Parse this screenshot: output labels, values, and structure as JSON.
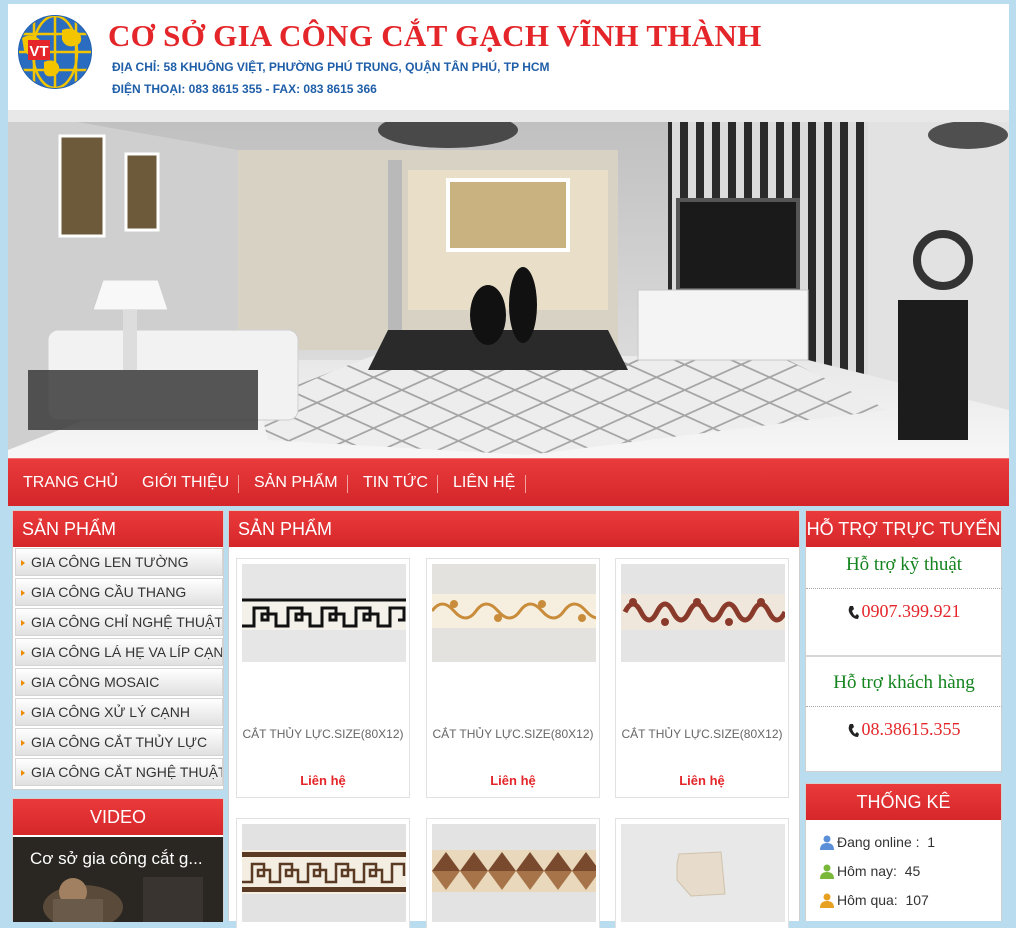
{
  "header": {
    "title": "CƠ SỞ GIA CÔNG CẮT GẠCH VĨNH THÀNH",
    "address": "ĐỊA CHỈ: 58 KHUÔNG VIỆT, PHƯỜNG PHÚ TRUNG, QUẬN TÂN PHÚ, TP HCM",
    "phone": "ĐIỆN THOẠI: 083 8615 355 -   FAX: 083 8615 366",
    "logo_text": "VT"
  },
  "nav": [
    "TRANG CHỦ",
    "GIỚI THIỆU",
    "SẢN PHẨM",
    "TIN TỨC",
    "LIÊN HỆ"
  ],
  "sidebar": {
    "title": "SẢN PHẨM",
    "items": [
      "GIA CÔNG LEN TƯỜNG",
      "GIA CÔNG CẦU THANG",
      "GIA CÔNG CHỈ NGHỆ THUẬT",
      "GIA CÔNG LÁ HẸ VA LÍP CẠNH",
      "GIA CÔNG MOSAIC",
      "GIA CÔNG XỬ LÝ CẠNH",
      "GIA CÔNG CẮT THỦY LỰC",
      "GIA CÔNG CẮT NGHỆ THUẬT"
    ],
    "video_title": "VIDEO",
    "video_caption": "Cơ sở gia công cắt g..."
  },
  "main": {
    "title": "SẢN PHẨM",
    "products": [
      {
        "name": "CẮT THỦY LỰC.SIZE(80X12)",
        "contact": "Liên hệ"
      },
      {
        "name": "CẮT THỦY LỰC.SIZE(80X12)",
        "contact": "Liên hệ"
      },
      {
        "name": "CẮT THỦY LỰC.SIZE(80X12)",
        "contact": "Liên hệ"
      }
    ]
  },
  "support": {
    "title": "HỖ TRỢ TRỰC TUYẾN",
    "tech_title": "Hỗ trợ kỹ thuật",
    "tech_phone": "0907.399.921",
    "cust_title": "Hỗ trợ khách hàng",
    "cust_phone": "08.38615.355"
  },
  "stats": {
    "title": "THỐNG KÊ",
    "online_label": "Đang online :",
    "online_value": "1",
    "today_label": "Hôm nay:",
    "today_value": "45",
    "yesterday_label": "Hôm qua:",
    "yesterday_value": "107"
  },
  "colors": {
    "brand_red": "#e4262a",
    "header_blue": "#1f5ea8",
    "support_green": "#14841f",
    "page_bg": "#b9dcef"
  }
}
